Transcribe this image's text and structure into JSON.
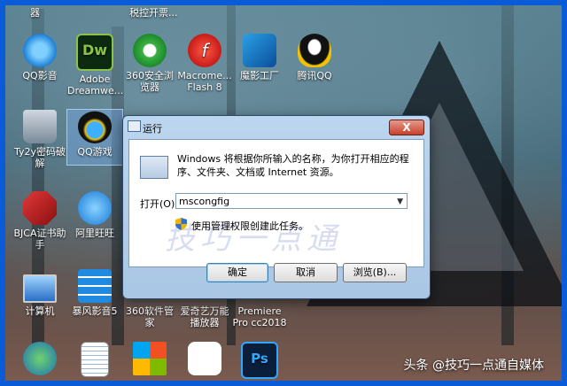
{
  "desktop": {
    "top_labels": [
      "器",
      "税控开票..."
    ],
    "icons": [
      {
        "label": "QQ影音",
        "icon": "qq-player-icon"
      },
      {
        "label": "Adobe Dreamwe...",
        "icon": "dreamweaver-icon"
      },
      {
        "label": "360安全浏览器",
        "icon": "360-browser-icon"
      },
      {
        "label": "Macrome... Flash 8",
        "icon": "flash-icon"
      },
      {
        "label": "魔影工厂",
        "icon": "moying-factory-icon"
      },
      {
        "label": "腾讯QQ",
        "icon": "qq-penguin-icon"
      },
      {
        "label": "Ty2y密码破解",
        "icon": "lock-icon"
      },
      {
        "label": "QQ游戏",
        "icon": "qq-game-icon"
      },
      {
        "label": "BJCA证书助手",
        "icon": "bjca-icon"
      },
      {
        "label": "阿里旺旺",
        "icon": "aliwangwang-icon"
      },
      {
        "label": "计算机",
        "icon": "computer-icon"
      },
      {
        "label": "暴风影音5",
        "icon": "baofeng-icon"
      },
      {
        "label": "360软件管家",
        "icon": "360-software-icon"
      },
      {
        "label": "爱奇艺万能播放器",
        "icon": "iqiyi-player-icon"
      },
      {
        "label": "Premiere Pro cc2018",
        "icon": "premiere-icon"
      },
      {
        "label": "",
        "icon": "network-globe-icon"
      },
      {
        "label": "",
        "icon": "document-icon"
      },
      {
        "label": "",
        "icon": "windows-logo-icon"
      },
      {
        "label": "",
        "icon": "cloud-icon"
      },
      {
        "label": "",
        "icon": "photoshop-icon"
      }
    ]
  },
  "run_dialog": {
    "title": "运行",
    "close": "X",
    "description": "Windows 将根据你所输入的名称，为你打开相应的程序、文件夹、文档或 Internet 资源。",
    "open_label": "打开(O):",
    "open_value": "mscongfig",
    "admin_note": "使用管理权限创建此任务。",
    "ok": "确定",
    "cancel": "取消",
    "browse": "浏览(B)...",
    "watermark": "技巧一点通"
  },
  "branding": {
    "footer_text": "头条 @技巧一点通自媒体"
  }
}
